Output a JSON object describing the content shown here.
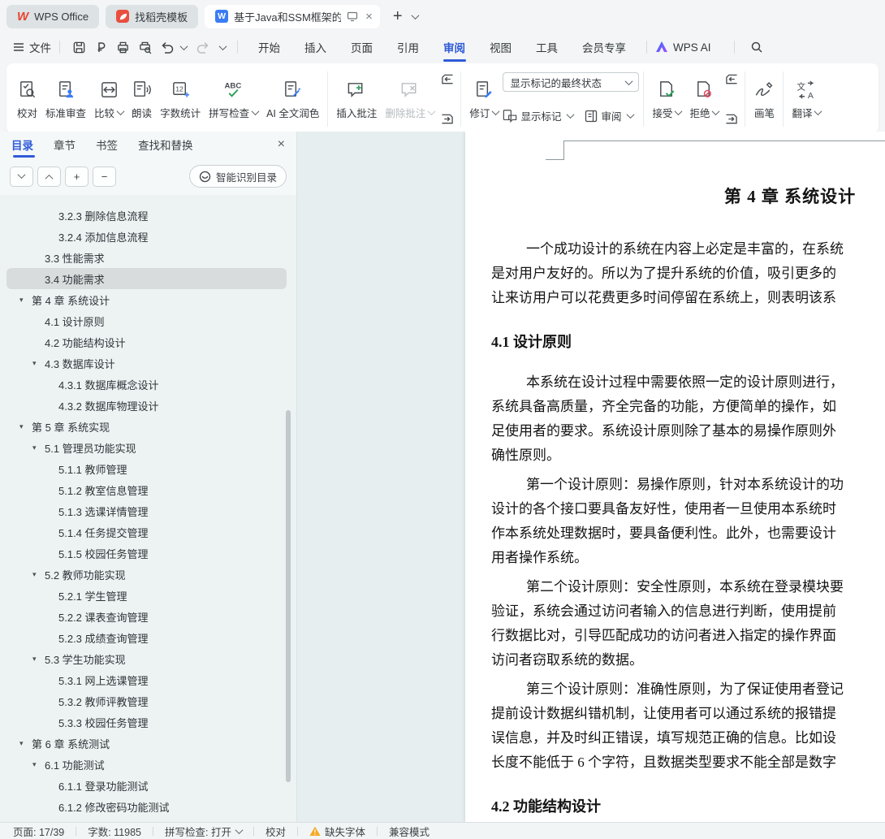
{
  "glyphs": {
    "close": "×",
    "plus": "+",
    "minus": "−",
    "triangle": "▾",
    "wps_w": "W",
    "doc_w": "W"
  },
  "tab_bar": {
    "home_tab": "WPS Office",
    "docer_tab": "找稻壳模板",
    "doc_tab": "基于Java和SSM框架的校园教"
  },
  "menu_bar": {
    "file": "文件",
    "items": [
      "开始",
      "插入",
      "页面",
      "引用",
      "审阅",
      "视图",
      "工具",
      "会员专享"
    ],
    "active": "审阅",
    "wps_ai": "WPS AI"
  },
  "ribbon": {
    "proofread": "校对",
    "standard_review": "标准审查",
    "compare": "比较",
    "read_aloud": "朗读",
    "word_count": "字数统计",
    "spell_check": "拼写检查",
    "ai_polish": "AI 全文润色",
    "insert_comment": "插入批注",
    "delete_comment": "删除批注",
    "track_changes": "修订",
    "markup_state": "显示标记的最终状态",
    "show_markup": "显示标记",
    "review_pane": "审阅",
    "accept": "接受",
    "reject": "拒绝",
    "pen": "画笔",
    "translate": "翻译"
  },
  "sidebar": {
    "tabs": [
      "目录",
      "章节",
      "书签",
      "查找和替换"
    ],
    "active_tab": "目录",
    "smart_toc": "智能识别目录",
    "toc": [
      {
        "level": 3,
        "label": "3.2.3 删除信息流程"
      },
      {
        "level": 3,
        "label": "3.2.4 添加信息流程"
      },
      {
        "level": 2,
        "label": "3.3 性能需求"
      },
      {
        "level": 2,
        "label": "3.4 功能需求",
        "selected": true
      },
      {
        "level": 1,
        "label": "第 4 章 系统设计",
        "expand": true
      },
      {
        "level": 2,
        "label": "4.1 设计原则"
      },
      {
        "level": 2,
        "label": "4.2 功能结构设计"
      },
      {
        "level": 2,
        "label": "4.3 数据库设计",
        "expand": true
      },
      {
        "level": 3,
        "label": "4.3.1 数据库概念设计"
      },
      {
        "level": 3,
        "label": "4.3.2 数据库物理设计"
      },
      {
        "level": 1,
        "label": "第 5 章 系统实现",
        "expand": true
      },
      {
        "level": 2,
        "label": "5.1 管理员功能实现",
        "expand": true
      },
      {
        "level": 3,
        "label": "5.1.1 教师管理"
      },
      {
        "level": 3,
        "label": "5.1.2 教室信息管理"
      },
      {
        "level": 3,
        "label": "5.1.3 选课详情管理"
      },
      {
        "level": 3,
        "label": "5.1.4 任务提交管理"
      },
      {
        "level": 3,
        "label": "5.1.5 校园任务管理"
      },
      {
        "level": 2,
        "label": "5.2 教师功能实现",
        "expand": true
      },
      {
        "level": 3,
        "label": "5.2.1 学生管理"
      },
      {
        "level": 3,
        "label": "5.2.2 课表查询管理"
      },
      {
        "level": 3,
        "label": "5.2.3 成绩查询管理"
      },
      {
        "level": 2,
        "label": "5.3 学生功能实现",
        "expand": true
      },
      {
        "level": 3,
        "label": "5.3.1 网上选课管理"
      },
      {
        "level": 3,
        "label": "5.3.2 教师评教管理"
      },
      {
        "level": 3,
        "label": "5.3.3 校园任务管理"
      },
      {
        "level": 1,
        "label": "第 6 章 系统测试",
        "expand": true
      },
      {
        "level": 2,
        "label": "6.1 功能测试",
        "expand": true
      },
      {
        "level": 3,
        "label": "6.1.1 登录功能测试"
      },
      {
        "level": 3,
        "label": "6.1.2 修改密码功能测试"
      }
    ]
  },
  "document": {
    "chapter_title": "第 4 章 系统设计",
    "blocks": [
      {
        "type": "p",
        "lines": [
          "一个成功设计的系统在内容上必定是丰富的，在系统",
          "是对用户友好的。所以为了提升系统的价值，吸引更多的",
          "让来访用户可以花费更多时间停留在系统上，则表明该系"
        ]
      },
      {
        "type": "h2",
        "text": "4.1 设计原则"
      },
      {
        "type": "p",
        "lines": [
          "本系统在设计过程中需要依照一定的设计原则进行，",
          "系统具备高质量，齐全完备的功能，方便简单的操作，如",
          "足使用者的要求。系统设计原则除了基本的易操作原则外",
          "确性原则。"
        ]
      },
      {
        "type": "p",
        "lines": [
          "第一个设计原则：易操作原则，针对本系统设计的功",
          "设计的各个接口要具备友好性，使用者一旦使用本系统时",
          "作本系统处理数据时，要具备便利性。此外，也需要设计",
          "用者操作系统。"
        ]
      },
      {
        "type": "p",
        "lines": [
          "第二个设计原则：安全性原则，本系统在登录模块要",
          "验证，系统会通过访问者输入的信息进行判断，使用提前",
          "行数据比对，引导匹配成功的访问者进入指定的操作界面",
          "访问者窃取系统的数据。"
        ]
      },
      {
        "type": "p",
        "lines": [
          "第三个设计原则：准确性原则，为了保证使用者登记",
          "提前设计数据纠错机制，让使用者可以通过系统的报错提",
          "误信息，并及时纠正错误，填写规范正确的信息。比如设",
          "长度不能低于 6 个字符，且数据类型要求不能全部是数字"
        ]
      },
      {
        "type": "h2",
        "text": "4.2 功能结构设计"
      }
    ]
  },
  "status_bar": {
    "page": "页面: 17/39",
    "words": "字数: 11985",
    "spellcheck": "拼写检查: 打开",
    "proofread": "校对",
    "missing_font": "缺失字体",
    "compat": "兼容模式"
  }
}
